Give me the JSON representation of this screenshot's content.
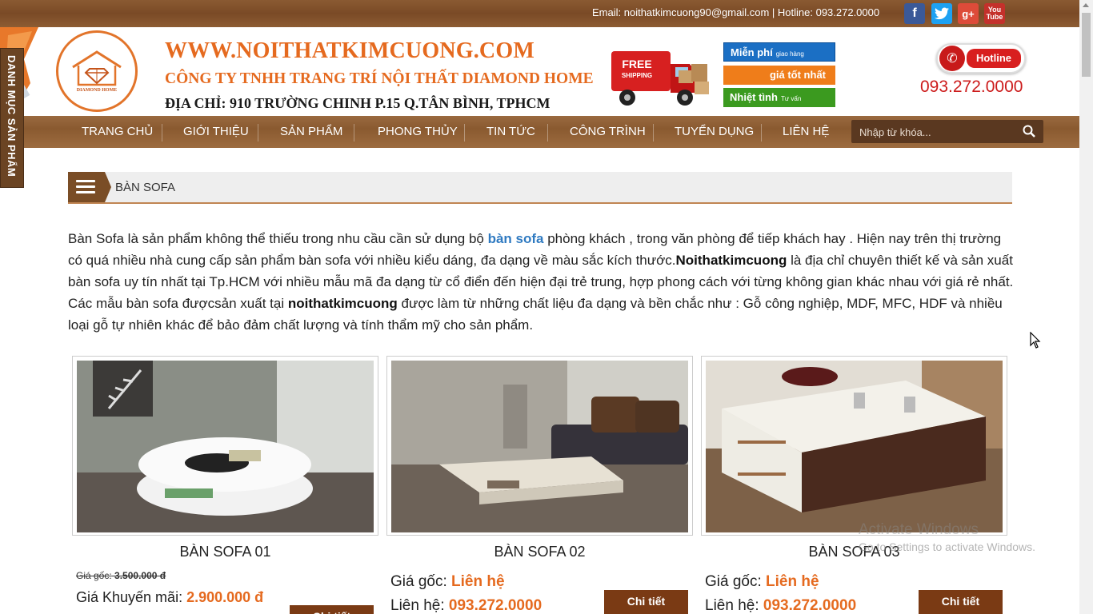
{
  "topbar": {
    "contact": "Email: noithatkimcuong90@gmail.com  |  Hotline: 093.272.0000",
    "social": [
      {
        "label": "f",
        "icon": "facebook-icon"
      },
      {
        "label": "t",
        "icon": "twitter-icon"
      },
      {
        "label": "g+",
        "icon": "google-plus-icon"
      },
      {
        "label": "You Tube",
        "icon": "youtube-icon"
      }
    ]
  },
  "header": {
    "logo_text": "DIAMOND HOME",
    "site_name": "WWW.NOITHATKIMCUONG.COM",
    "company": "CÔNG TY TNHH TRANG TRÍ NỘI THẤT DIAMOND HOME",
    "address": "ĐỊA CHỈ: 910 TRƯỜNG CHINH P.15 Q.TÂN BÌNH, TPHCM",
    "truck_text": [
      "FREE",
      "SHIPPING"
    ],
    "badges": [
      {
        "main": "Miễn phí",
        "sub": "giao hàng"
      },
      {
        "main": "giá tốt nhất",
        "sub": ""
      },
      {
        "main": "Nhiệt tình",
        "sub": "Tư vấn"
      }
    ],
    "hotline_label": "Hotline",
    "hotline_number": "093.272.0000"
  },
  "nav": {
    "items": [
      "TRANG CHỦ",
      "GIỚI THIỆU",
      "SẢN PHẨM",
      "PHONG THỦY",
      "TIN TỨC",
      "CÔNG TRÌNH",
      "TUYỂN DỤNG",
      "LIÊN HỆ"
    ],
    "search_placeholder": "Nhập từ khóa..."
  },
  "sidetab": {
    "label": "DANH MỤC SẢN PHẨM"
  },
  "breadcrumb": {
    "title": "BÀN SOFA"
  },
  "intro": {
    "p1": "Bàn Sofa là sản phẩm không thể thiếu trong  nhu cầu cần sử dụng bộ ",
    "link": "bàn sofa",
    "p2": " phòng khách , trong văn phòng để tiếp khách hay . Hiện nay trên thị trường có quá nhiều nhà cung cấp sản phẩm bàn sofa với nhiều kiểu dáng, đa dạng về màu sắc kích thước.",
    "brand1": "Noithatkimcuong",
    "p3": " là địa chỉ chuyên thiết kế và sản xuất bàn sofa uy tín nhất tại Tp.HCM với nhiều mẫu mã đa dạng từ cổ điển đến hiện đại trẻ trung, hợp phong cách với từng không gian khác nhau với giá rẻ nhất. Các mẫu bàn sofa đượcsản xuất tại ",
    "brand2": "noithatkimcuong",
    "p4": " được làm từ những chất liệu đa dạng và bền chắc như : Gỗ công nghiệp, MDF, MFC, HDF và nhiều loại gỗ tự nhiên khác để bảo đảm chất lượng và tính thẩm mỹ cho sản phẩm."
  },
  "products": [
    {
      "name": "BÀN SOFA 01",
      "old_label": "Giá gốc:",
      "old_price": "3.500.000 đ",
      "promo_label": "Giá Khuyến mãi:",
      "promo_price": "2.900.000 đ",
      "detail": "Chi tiết"
    },
    {
      "name": "BÀN SOFA 02",
      "price_label": "Giá gốc:",
      "price": "Liên hệ",
      "contact_label": "Liên hệ:",
      "contact": "093.272.0000",
      "detail": "Chi tiết"
    },
    {
      "name": "BÀN SOFA 03",
      "price_label": "Giá gốc:",
      "price": "Liên hệ",
      "contact_label": "Liên hệ:",
      "contact": "093.272.0000",
      "detail": "Chi tiết"
    }
  ],
  "watermark": {
    "line1": "Activate Windows",
    "line2": "Go to Settings to activate Windows."
  },
  "colors": {
    "brand_orange": "#e56a1f",
    "wood": "#8a5a30",
    "hotline_red": "#cc1b1b",
    "link_blue": "#2f7ac1"
  }
}
